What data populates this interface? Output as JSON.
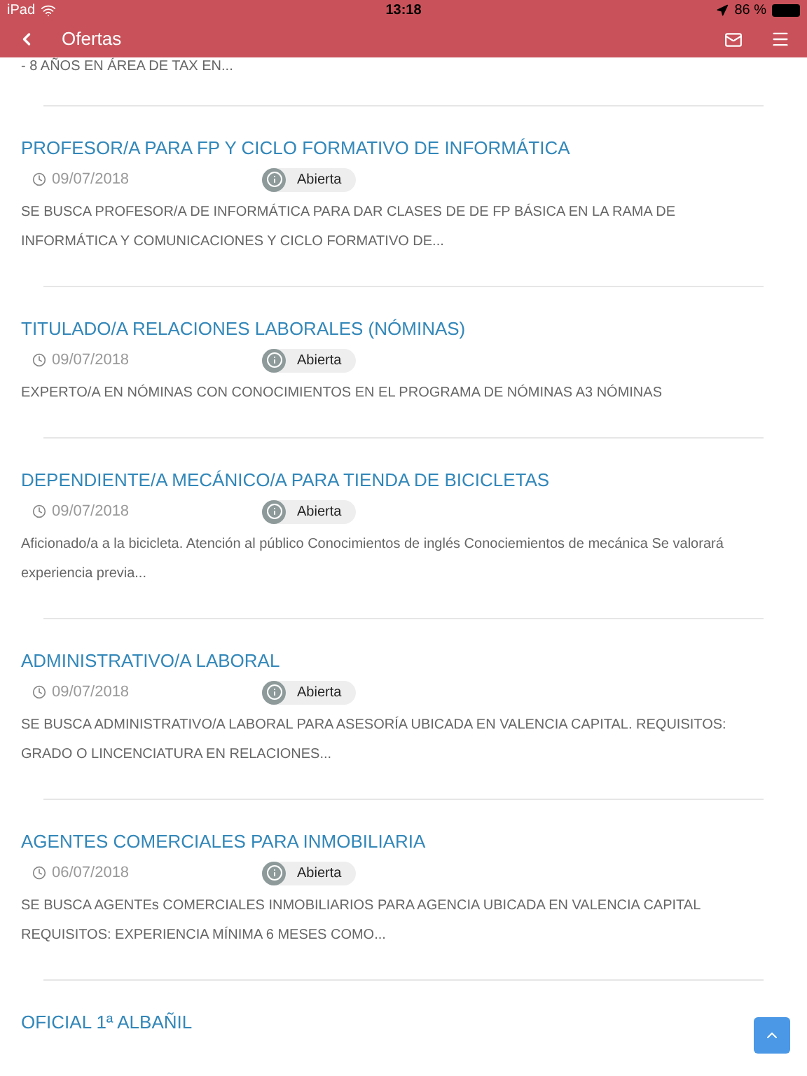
{
  "status_bar": {
    "device": "iPad",
    "time": "13:18",
    "battery": "86 %"
  },
  "header": {
    "title": "Ofertas"
  },
  "partial_text": "- 8 AÑOS EN ÁREA DE TAX EN...",
  "offers": [
    {
      "title": "PROFESOR/A PARA FP Y CICLO FORMATIVO DE INFORMÁTICA",
      "date": "09/07/2018",
      "status": "Abierta",
      "description": "SE BUSCA PROFESOR/A DE INFORMÁTICA PARA DAR CLASES DE DE FP BÁSICA  EN LA RAMA DE INFORMÁTICA Y COMUNICACIONES Y CICLO FORMATIVO DE..."
    },
    {
      "title": "TITULADO/A RELACIONES LABORALES (NÓMINAS)",
      "date": "09/07/2018",
      "status": "Abierta",
      "description": "EXPERTO/A EN NÓMINAS CON CONOCIMIENTOS EN EL PROGRAMA DE NÓMINAS A3 NÓMINAS"
    },
    {
      "title": "DEPENDIENTE/A MECÁNICO/A PARA TIENDA DE BICICLETAS",
      "date": "09/07/2018",
      "status": "Abierta",
      "description": "Aficionado/a a la bicicleta. Atención al público Conocimientos de inglés Conociemientos de mecánica Se valorará experiencia previa..."
    },
    {
      "title": "ADMINISTRATIVO/A LABORAL",
      "date": "09/07/2018",
      "status": "Abierta",
      "description": "SE BUSCA ADMINISTRATIVO/A LABORAL PARA ASESORÍA UBICADA EN VALENCIA CAPITAL. REQUISITOS: GRADO O LINCENCIATURA EN RELACIONES..."
    },
    {
      "title": "AGENTES COMERCIALES PARA INMOBILIARIA",
      "date": "06/07/2018",
      "status": "Abierta",
      "description": "SE BUSCA AGENTEs COMERCIALES  INMOBILIARIOS  PARA AGENCIA UBICADA EN VALENCIA CAPITAL REQUISITOS: EXPERIENCIA MÍNIMA 6 MESES COMO..."
    },
    {
      "title": "OFICIAL 1ª ALBAÑIL"
    }
  ]
}
